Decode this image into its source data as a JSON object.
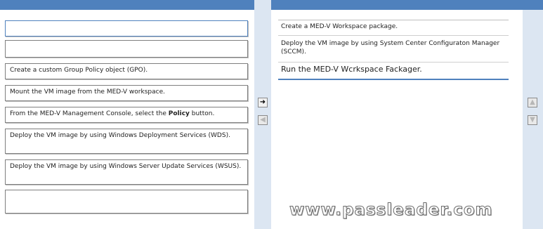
{
  "source_list": {
    "items": [
      {
        "text": ""
      },
      {
        "text": ""
      },
      {
        "text": "Create a custom Group Policy object (GPO)."
      },
      {
        "text": "Mount the VM image from the MED-V workspace."
      },
      {
        "text_before": "From the MED-V Management Console, select the ",
        "bold": "Policy",
        "text_after": " button."
      },
      {
        "text": "Deploy the VM image by using Windows Deployment Services (WDS)."
      },
      {
        "text": "Deploy the VM image by using Windows Server Update Services (WSUS)."
      },
      {
        "text": ""
      }
    ]
  },
  "target_list": {
    "items": [
      {
        "text": "Create a MED-V Workspace package."
      },
      {
        "text": "Deploy the VM image by using System Center Configuraton Manager (SCCM)."
      },
      {
        "text": "Run the MED-V Wcrkspace Fackager."
      }
    ]
  },
  "controls": {
    "move_right": "➜",
    "move_left": "◀",
    "move_up": "▲",
    "move_down": "▼"
  },
  "watermark": "www.passleader.com",
  "colors": {
    "header_blue": "#4f81bd",
    "gutter": "#dce6f2"
  }
}
